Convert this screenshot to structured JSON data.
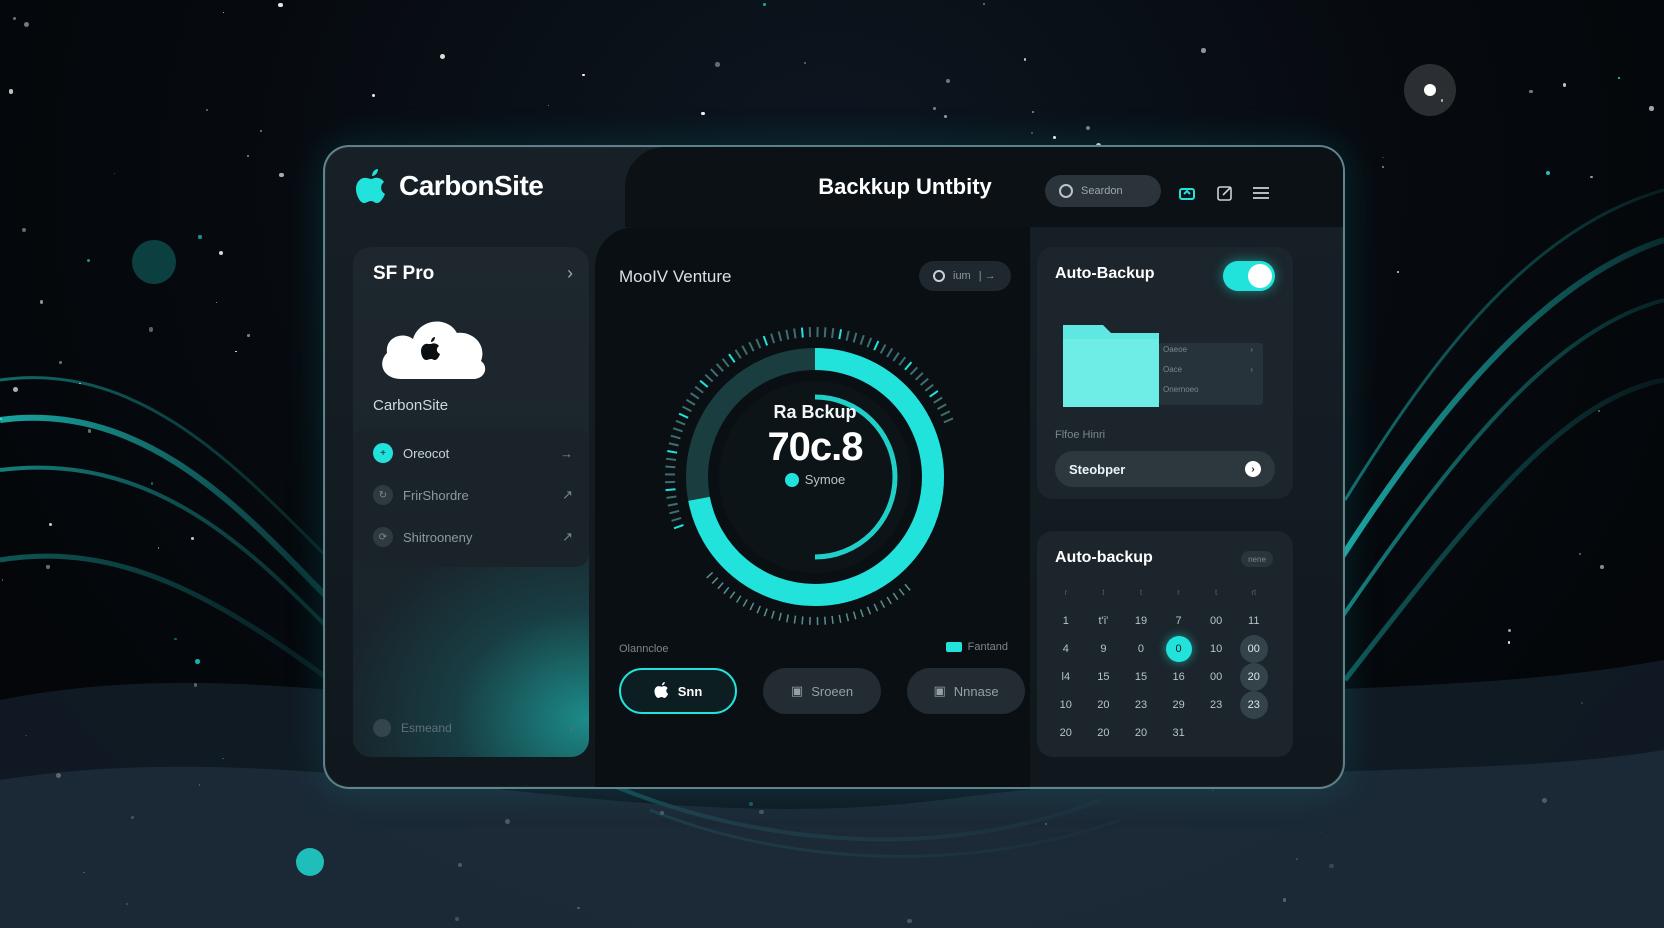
{
  "brand": {
    "name": "CarbonSite"
  },
  "titlebar": {
    "app_title": "Backkup Untbity",
    "search_placeholder": "Seardon"
  },
  "icons": {
    "toolbar": [
      "cloud-sync-icon",
      "edit-icon",
      "menu-icon"
    ]
  },
  "sidebar": {
    "header": "SF Pro",
    "brand_label": "CarbonSite",
    "items": [
      {
        "label": "Oreocot",
        "icon": "plus-icon",
        "active": true
      },
      {
        "label": "FrirShordre",
        "icon": "refresh-icon",
        "active": false
      },
      {
        "label": "Shitrooneny",
        "icon": "sync-icon",
        "active": false
      }
    ],
    "bottom_item": "Esmeand"
  },
  "center": {
    "title": "MooIV Venture",
    "pill_label": "ium",
    "gauge": {
      "label": "Ra Bckup",
      "value": "70c.8",
      "status": "Symoe",
      "progress": 0.72
    },
    "footer_left": "Olanncloe",
    "footer_right": "Fantand",
    "buttons": {
      "primary": "Snn",
      "secondary_1": "Sroeen",
      "secondary_2": "Nnnase"
    }
  },
  "auto_backup": {
    "title": "Auto-Backup",
    "enabled": true,
    "folder_rows": [
      "Oaeoe",
      "Oace",
      "Onernoeo"
    ],
    "field_label": "Flfoe Hinri",
    "select_value": "Steobper"
  },
  "calendar": {
    "title": "Auto-backup",
    "chip": "nene",
    "weekday_headers": [
      "r",
      "t",
      "t",
      "r",
      "t",
      "rt"
    ],
    "rows": [
      [
        "1",
        "t'i'",
        "19",
        "7",
        "00",
        "11"
      ],
      [
        "4",
        "9",
        "0",
        "0",
        "10",
        "00"
      ],
      [
        "l4",
        "15",
        "15",
        "16",
        "00",
        "20"
      ],
      [
        "10",
        "20",
        "23",
        "29",
        "23",
        "23"
      ],
      [
        "20",
        "20",
        "20",
        "31",
        "",
        ""
      ]
    ],
    "selected": "0",
    "marked": [
      "00",
      "20",
      "23"
    ]
  },
  "colors": {
    "accent": "#22e3dc",
    "panel": "#1b252b",
    "background": "#05080c"
  }
}
